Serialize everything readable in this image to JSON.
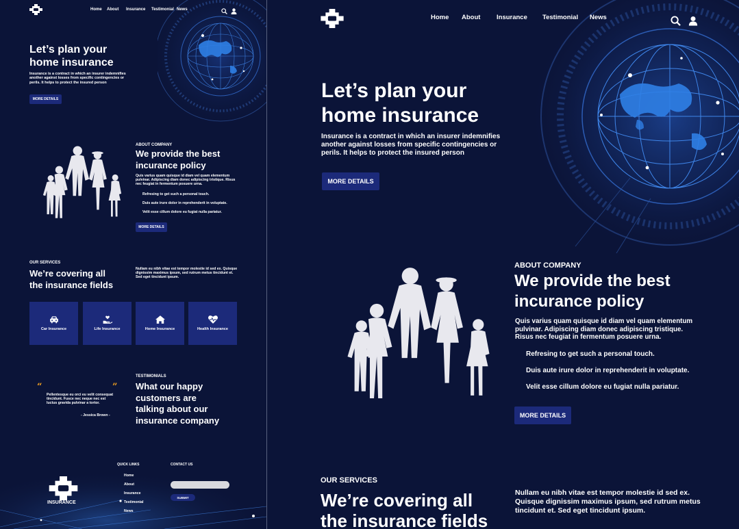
{
  "brand": {
    "name": "INSURANCE"
  },
  "nav": {
    "items": [
      "Home",
      "About",
      "Insurance",
      "Testimonial",
      "News"
    ]
  },
  "hero": {
    "title_line1": "Let’s plan your",
    "title_line2": "home insurance",
    "description": "Insurance is a contract in which an insurer indemnifies another against losses from specific contingencies or perils. It helps to protect the insured person",
    "button": "MORE DETAILS"
  },
  "about": {
    "kicker": "ABOUT COMPANY",
    "title_line1": "We provide the best",
    "title_line2": "incurance policy",
    "paragraph": "Quis varius quam quisque id diam vel quam elementum pulvinar. Adipiscing diam donec adipiscing tristique. Risus nec feugiat in fermentum posuere urna.",
    "bullets": [
      "Refresing to get such a personal touch.",
      "Duis aute irure dolor in reprehenderit in voluptate.",
      "Velit esse cillum dolore eu fugiat nulla pariatur."
    ],
    "button": "MORE DETAILS"
  },
  "services": {
    "kicker": "OUR SERVICES",
    "title_line1": "We’re covering all",
    "title_line2": "the insurance fields",
    "paragraph": "Nullam eu nibh vitae est tempor molestie id sed ex. Quisque dignissim maximus ipsum, sed rutrum metus tincidunt et. Sed eget tincidunt ipsum.",
    "cards": [
      {
        "label": "Car Insurance",
        "icon": "car-icon"
      },
      {
        "label": "Life Insurance",
        "icon": "heart-hand-icon"
      },
      {
        "label": "Home Insurance",
        "icon": "home-icon"
      },
      {
        "label": "Health Insurance",
        "icon": "heartbeat-icon"
      }
    ]
  },
  "testimonials": {
    "kicker": "TESTIMONIALS",
    "title_line1": "What our happy",
    "title_line2": "customers are",
    "title_line3": "talking about our",
    "title_line4": "insurance company",
    "quote": "Pellentesque eu orci eu velit consequat tincidunt. Fusce nec neque nec est luctus gravida pulvinar a tortor.",
    "author": "- Jessica Brown -"
  },
  "footer": {
    "quick_links_title": "QUICK LINKS",
    "quick_links": [
      "Home",
      "About",
      "Insurance",
      "Testimonial",
      "News"
    ],
    "contact_title": "CONTACT US",
    "submit": "SUBMIT"
  },
  "colors": {
    "background": "#0b1438",
    "button": "#1c2a7a",
    "globe": "#2f7fe6",
    "quote": "#f0a020"
  }
}
